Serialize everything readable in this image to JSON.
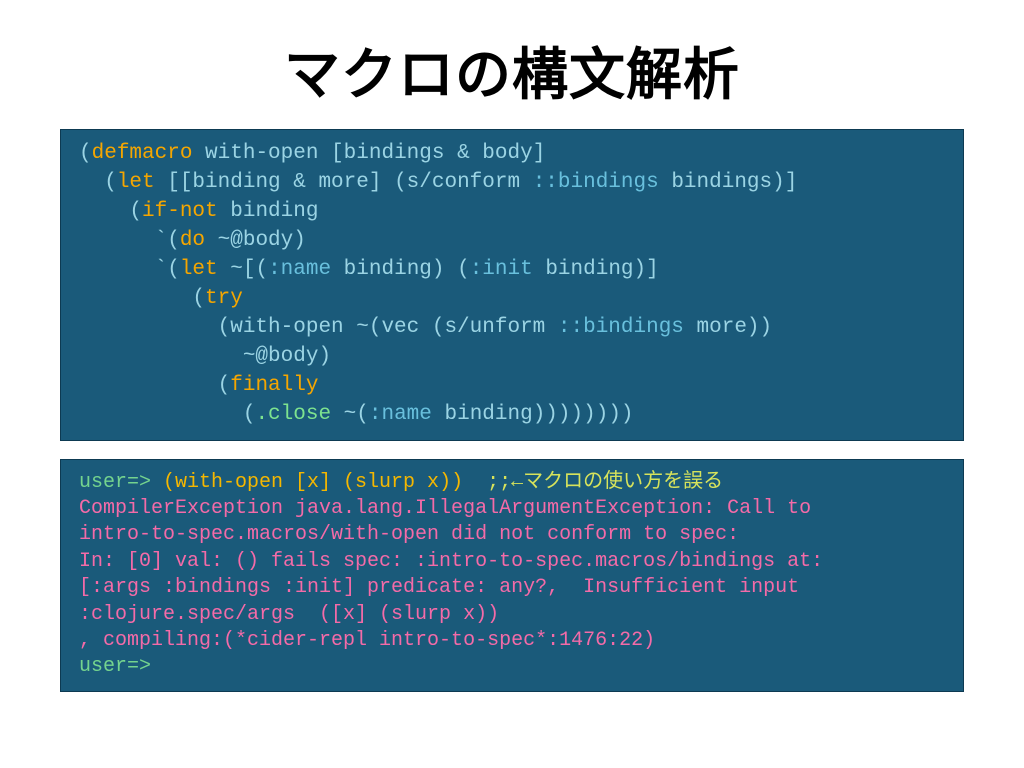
{
  "title": "マクロの構文解析",
  "code": {
    "l1a": "(",
    "l1b": "defmacro",
    "l1c": " with-open [bindings & body]",
    "l2a": "  (",
    "l2b": "let",
    "l2c": " [[binding & more] (s/conform ",
    "l2d": "::bindings",
    "l2e": " bindings)]",
    "l3a": "    (",
    "l3b": "if-not",
    "l3c": " binding",
    "l4a": "      `(",
    "l4b": "do",
    "l4c": " ~@body)",
    "l5a": "      `(",
    "l5b": "let",
    "l5c": " ~[(",
    "l5d": ":name",
    "l5e": " binding) (",
    "l5f": ":init",
    "l5g": " binding)]",
    "l6a": "         (",
    "l6b": "try",
    "l7a": "           (with-open ~(vec (s/unform ",
    "l7b": "::bindings",
    "l7c": " more))",
    "l8": "             ~@body)",
    "l9a": "           (",
    "l9b": "finally",
    "l10a": "             (",
    "l10b": ".close",
    "l10c": " ~(",
    "l10d": ":name",
    "l10e": " binding))))))))"
  },
  "repl": {
    "r1_prompt": "user=>",
    "r1_input": " (with-open [x] (slurp x))  ",
    "r1_comment": ";;←マクロの使い方を誤る",
    "r2": "CompilerException java.lang.IllegalArgumentException: Call to",
    "r3": "intro-to-spec.macros/with-open did not conform to spec:",
    "r4": "In: [0] val: () fails spec: :intro-to-spec.macros/bindings at:",
    "r5": "[:args :bindings :init] predicate: any?,  Insufficient input",
    "r6": ":clojure.spec/args  ([x] (slurp x))",
    "r7": ", compiling:(*cider-repl intro-to-spec*:1476:22)",
    "r8_prompt": "user=>"
  }
}
